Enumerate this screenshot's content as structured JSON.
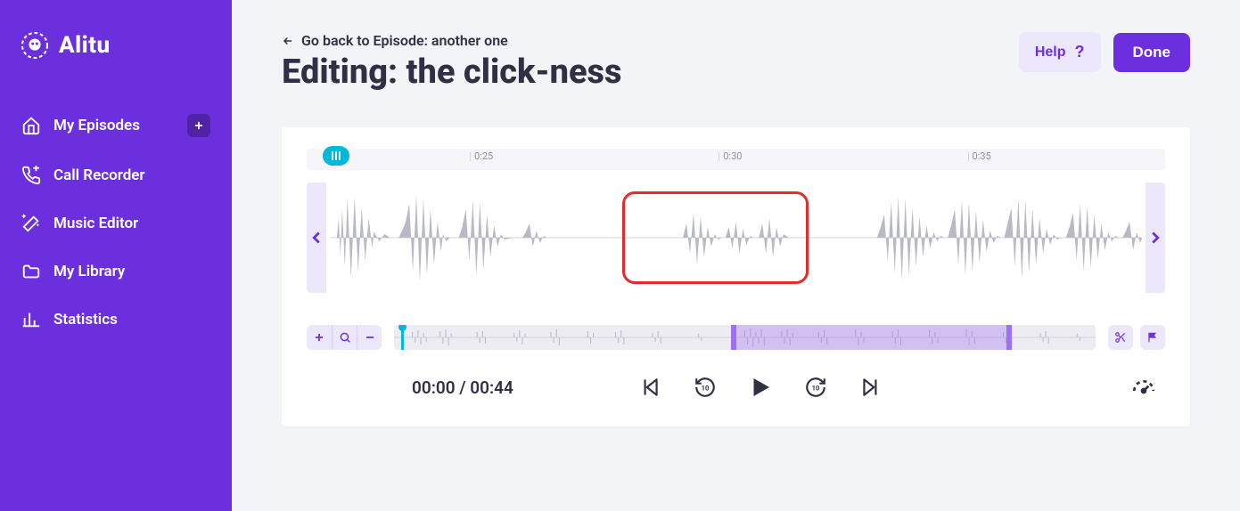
{
  "brand": {
    "name": "Alitu"
  },
  "sidebar": {
    "items": [
      {
        "label": "My Episodes",
        "icon": "home",
        "has_add": true
      },
      {
        "label": "Call Recorder",
        "icon": "phone"
      },
      {
        "label": "Music Editor",
        "icon": "wand"
      },
      {
        "label": "My Library",
        "icon": "folder"
      },
      {
        "label": "Statistics",
        "icon": "bars"
      }
    ]
  },
  "header": {
    "back_text": "Go back to Episode: another one",
    "title": "Editing: the click-ness",
    "help_label": "Help",
    "done_label": "Done"
  },
  "ruler": {
    "ticks": [
      "0:25",
      "0:30",
      "0:35"
    ]
  },
  "transport": {
    "current_time": "00:00",
    "total_time": "00:44"
  }
}
